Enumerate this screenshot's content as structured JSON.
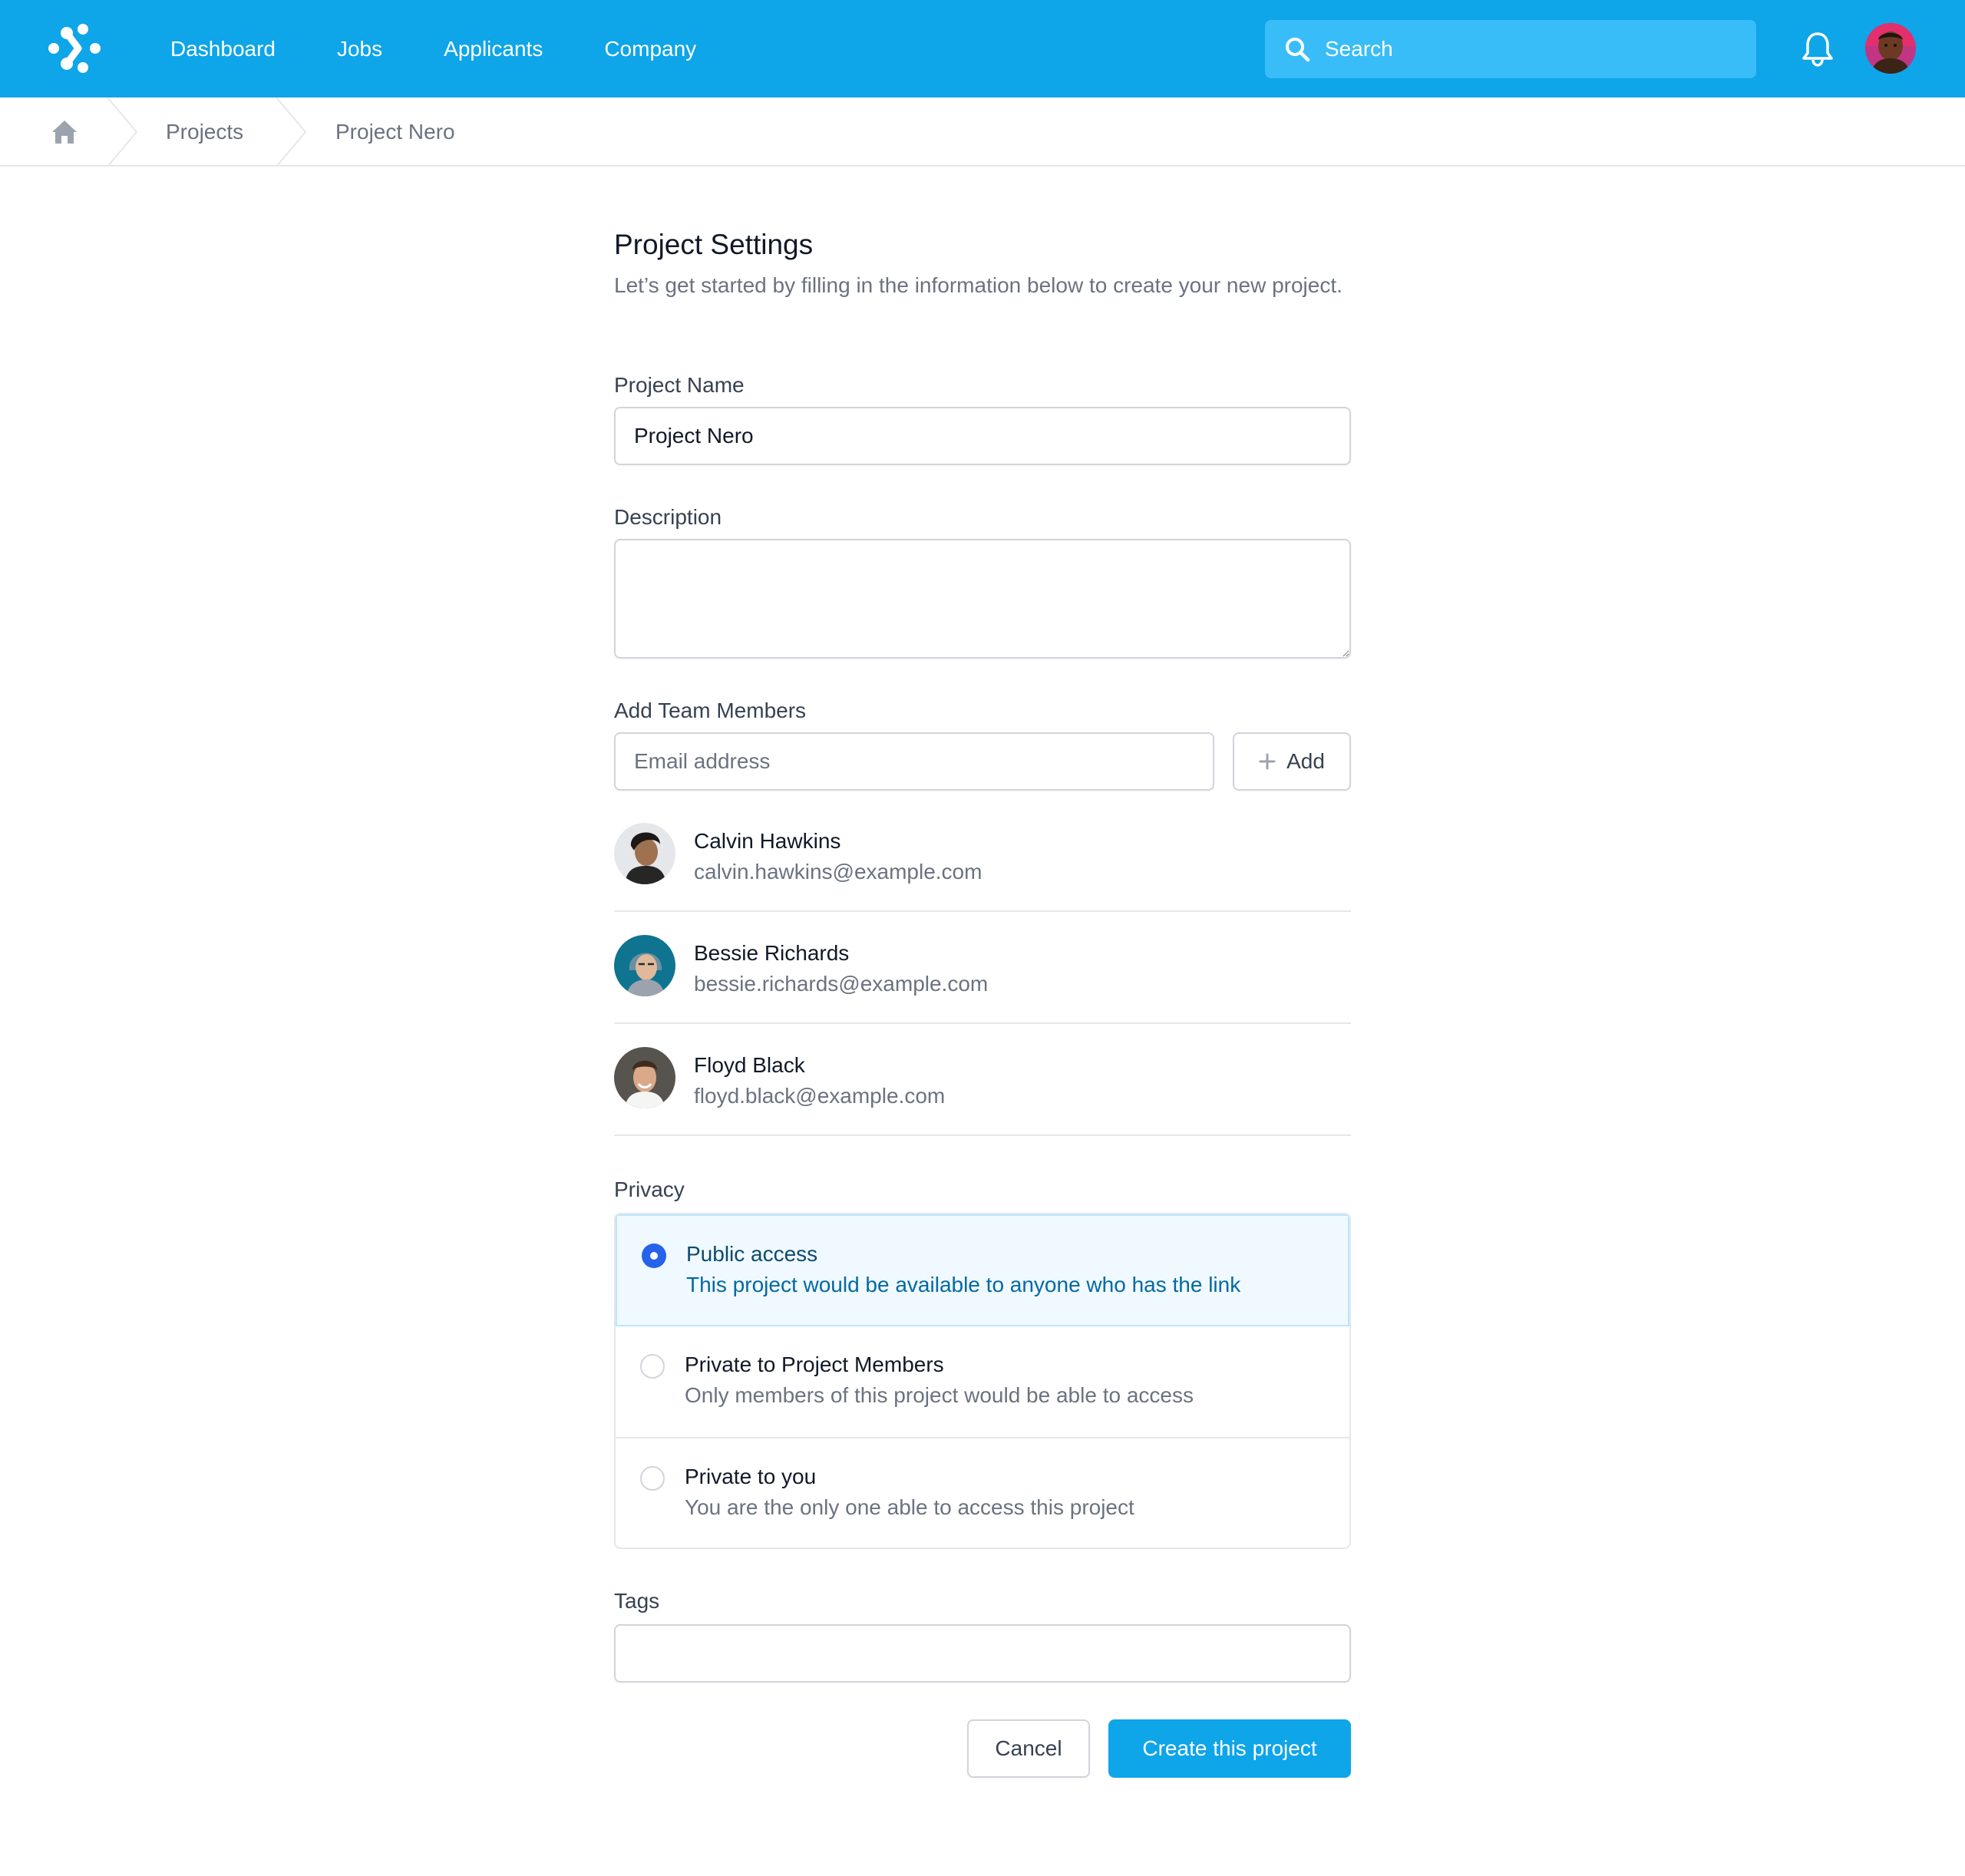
{
  "nav": {
    "links": [
      "Dashboard",
      "Jobs",
      "Applicants",
      "Company"
    ],
    "search_placeholder": "Search"
  },
  "breadcrumb": {
    "items": [
      "Projects",
      "Project Nero"
    ]
  },
  "form": {
    "title": "Project Settings",
    "subtitle": "Let’s get started by filling in the information below to create your new project.",
    "project_name_label": "Project Name",
    "project_name_value": "Project Nero",
    "description_label": "Description",
    "description_value": "",
    "team_label": "Add Team Members",
    "email_placeholder": "Email address",
    "add_button": "Add",
    "members": [
      {
        "name": "Calvin Hawkins",
        "email": "calvin.hawkins@example.com"
      },
      {
        "name": "Bessie Richards",
        "email": "bessie.richards@example.com"
      },
      {
        "name": "Floyd Black",
        "email": "floyd.black@example.com"
      }
    ],
    "privacy_label": "Privacy",
    "privacy_options": [
      {
        "title": "Public access",
        "description": "This project would be available to anyone who has the link",
        "selected": true
      },
      {
        "title": "Private to Project Members",
        "description": "Only members of this project would be able to access",
        "selected": false
      },
      {
        "title": "Private to you",
        "description": "You are the only one able to access this project",
        "selected": false
      }
    ],
    "tags_label": "Tags",
    "tags_value": "",
    "cancel_button": "Cancel",
    "create_button": "Create this project"
  },
  "colors": {
    "brand": "#0ea5e9",
    "search_bg": "#38bdf8",
    "radio_selected": "#2563eb",
    "selected_option_bg": "#f0f9ff"
  },
  "icons": [
    "logo-icon",
    "search-icon",
    "bell-icon",
    "home-icon",
    "plus-icon"
  ]
}
